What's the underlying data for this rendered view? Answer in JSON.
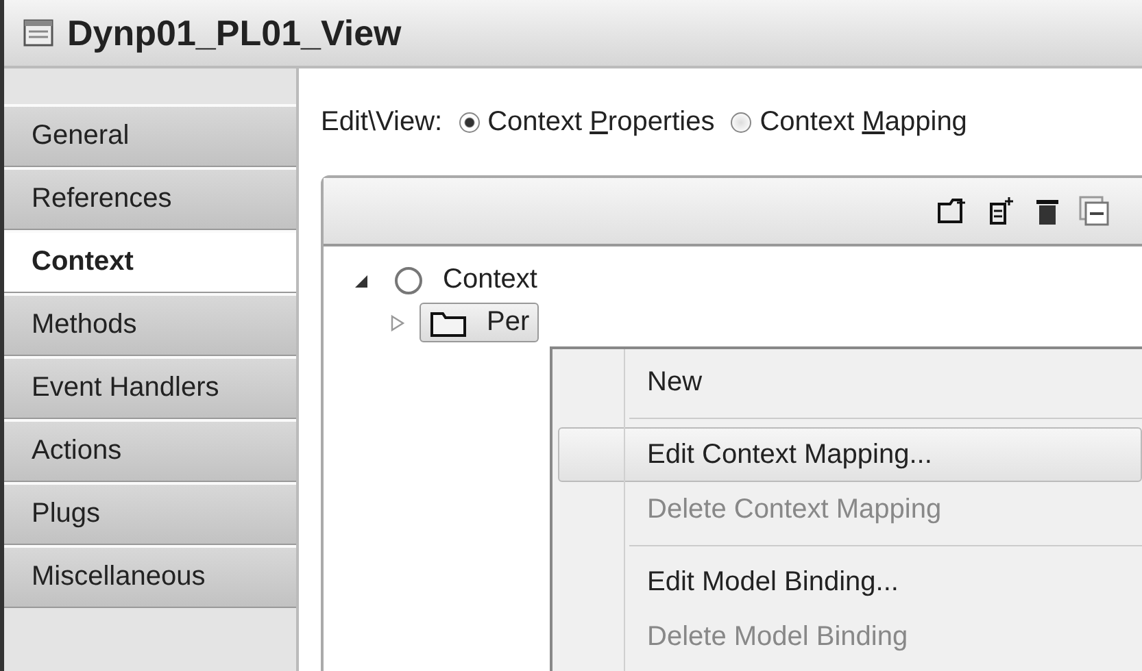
{
  "window": {
    "title": "Dynp01_PL01_View"
  },
  "sidebar": {
    "items": [
      {
        "label": "General",
        "selected": false
      },
      {
        "label": "References",
        "selected": false
      },
      {
        "label": "Context",
        "selected": true
      },
      {
        "label": "Methods",
        "selected": false
      },
      {
        "label": "Event Handlers",
        "selected": false
      },
      {
        "label": "Actions",
        "selected": false
      },
      {
        "label": "Plugs",
        "selected": false
      },
      {
        "label": "Miscellaneous",
        "selected": false
      }
    ]
  },
  "edit_view": {
    "label": "Edit\\View:",
    "options": [
      {
        "before": "Context ",
        "mnemonic": "P",
        "after": "roperties",
        "selected": true
      },
      {
        "before": "Context ",
        "mnemonic": "M",
        "after": "apping",
        "selected": false
      }
    ]
  },
  "tree": {
    "items": [
      {
        "label": "Context",
        "kind": "root",
        "expanded": true,
        "selected": false,
        "children": [
          {
            "label": "Per",
            "kind": "node",
            "expanded": false,
            "selected": true
          }
        ]
      }
    ]
  },
  "context_menu": {
    "items": [
      {
        "label": "New",
        "disabled": false,
        "highlighted": false,
        "separator_after": true
      },
      {
        "label": "Edit Context Mapping...",
        "disabled": false,
        "highlighted": true,
        "separator_after": false
      },
      {
        "label": "Delete Context Mapping",
        "disabled": true,
        "highlighted": false,
        "separator_after": true
      },
      {
        "label": "Edit Model Binding...",
        "disabled": false,
        "highlighted": false,
        "separator_after": false
      },
      {
        "label": "Delete Model Binding",
        "disabled": true,
        "highlighted": false,
        "separator_after": false
      }
    ]
  }
}
